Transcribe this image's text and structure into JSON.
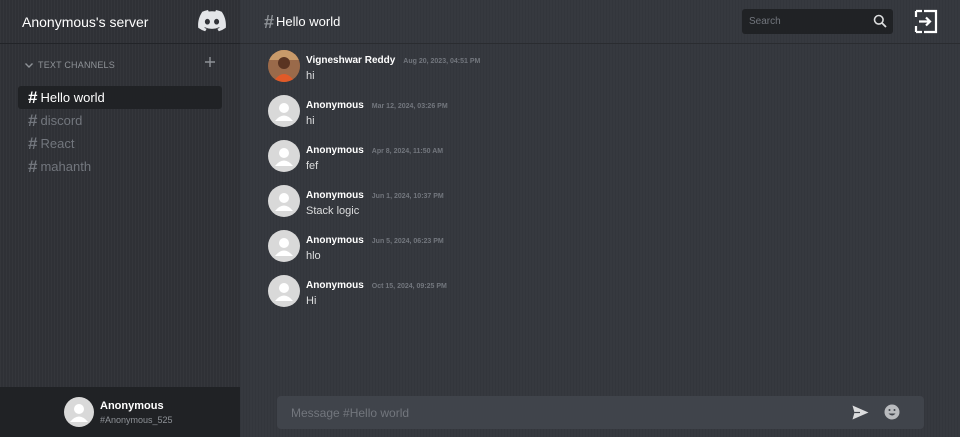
{
  "server": {
    "name": "Anonymous's server",
    "logo_icon": "discord-logo-icon"
  },
  "sidebar": {
    "section_label": "TEXT CHANNELS",
    "channels": [
      {
        "name": "Hello world",
        "active": true
      },
      {
        "name": "discord",
        "active": false
      },
      {
        "name": "React",
        "active": false
      },
      {
        "name": "mahanth",
        "active": false
      }
    ]
  },
  "user": {
    "name": "Anonymous",
    "tag": "#Anonymous_525"
  },
  "header": {
    "channel": "Hello world",
    "search_placeholder": "Search"
  },
  "messages": [
    {
      "author": "Vigneshwar Reddy",
      "time": "Aug 20, 2023, 04:51 PM",
      "text": "hi",
      "avatar": "photo"
    },
    {
      "author": "Anonymous",
      "time": "Mar 12, 2024, 03:26 PM",
      "text": "hi",
      "avatar": "default"
    },
    {
      "author": "Anonymous",
      "time": "Apr 8, 2024, 11:50 AM",
      "text": "fef",
      "avatar": "default"
    },
    {
      "author": "Anonymous",
      "time": "Jun 1, 2024, 10:37 PM",
      "text": "Stack logic",
      "avatar": "default"
    },
    {
      "author": "Anonymous",
      "time": "Jun 5, 2024, 06:23 PM",
      "text": "hlo",
      "avatar": "default"
    },
    {
      "author": "Anonymous",
      "time": "Oct 15, 2024, 09:25 PM",
      "text": "Hi",
      "avatar": "default"
    }
  ],
  "composer": {
    "placeholder": "Message #Hello world"
  },
  "colors": {
    "sidebar": "#2f3136",
    "main": "#36393f",
    "dark": "#202225",
    "input": "#40444b"
  }
}
